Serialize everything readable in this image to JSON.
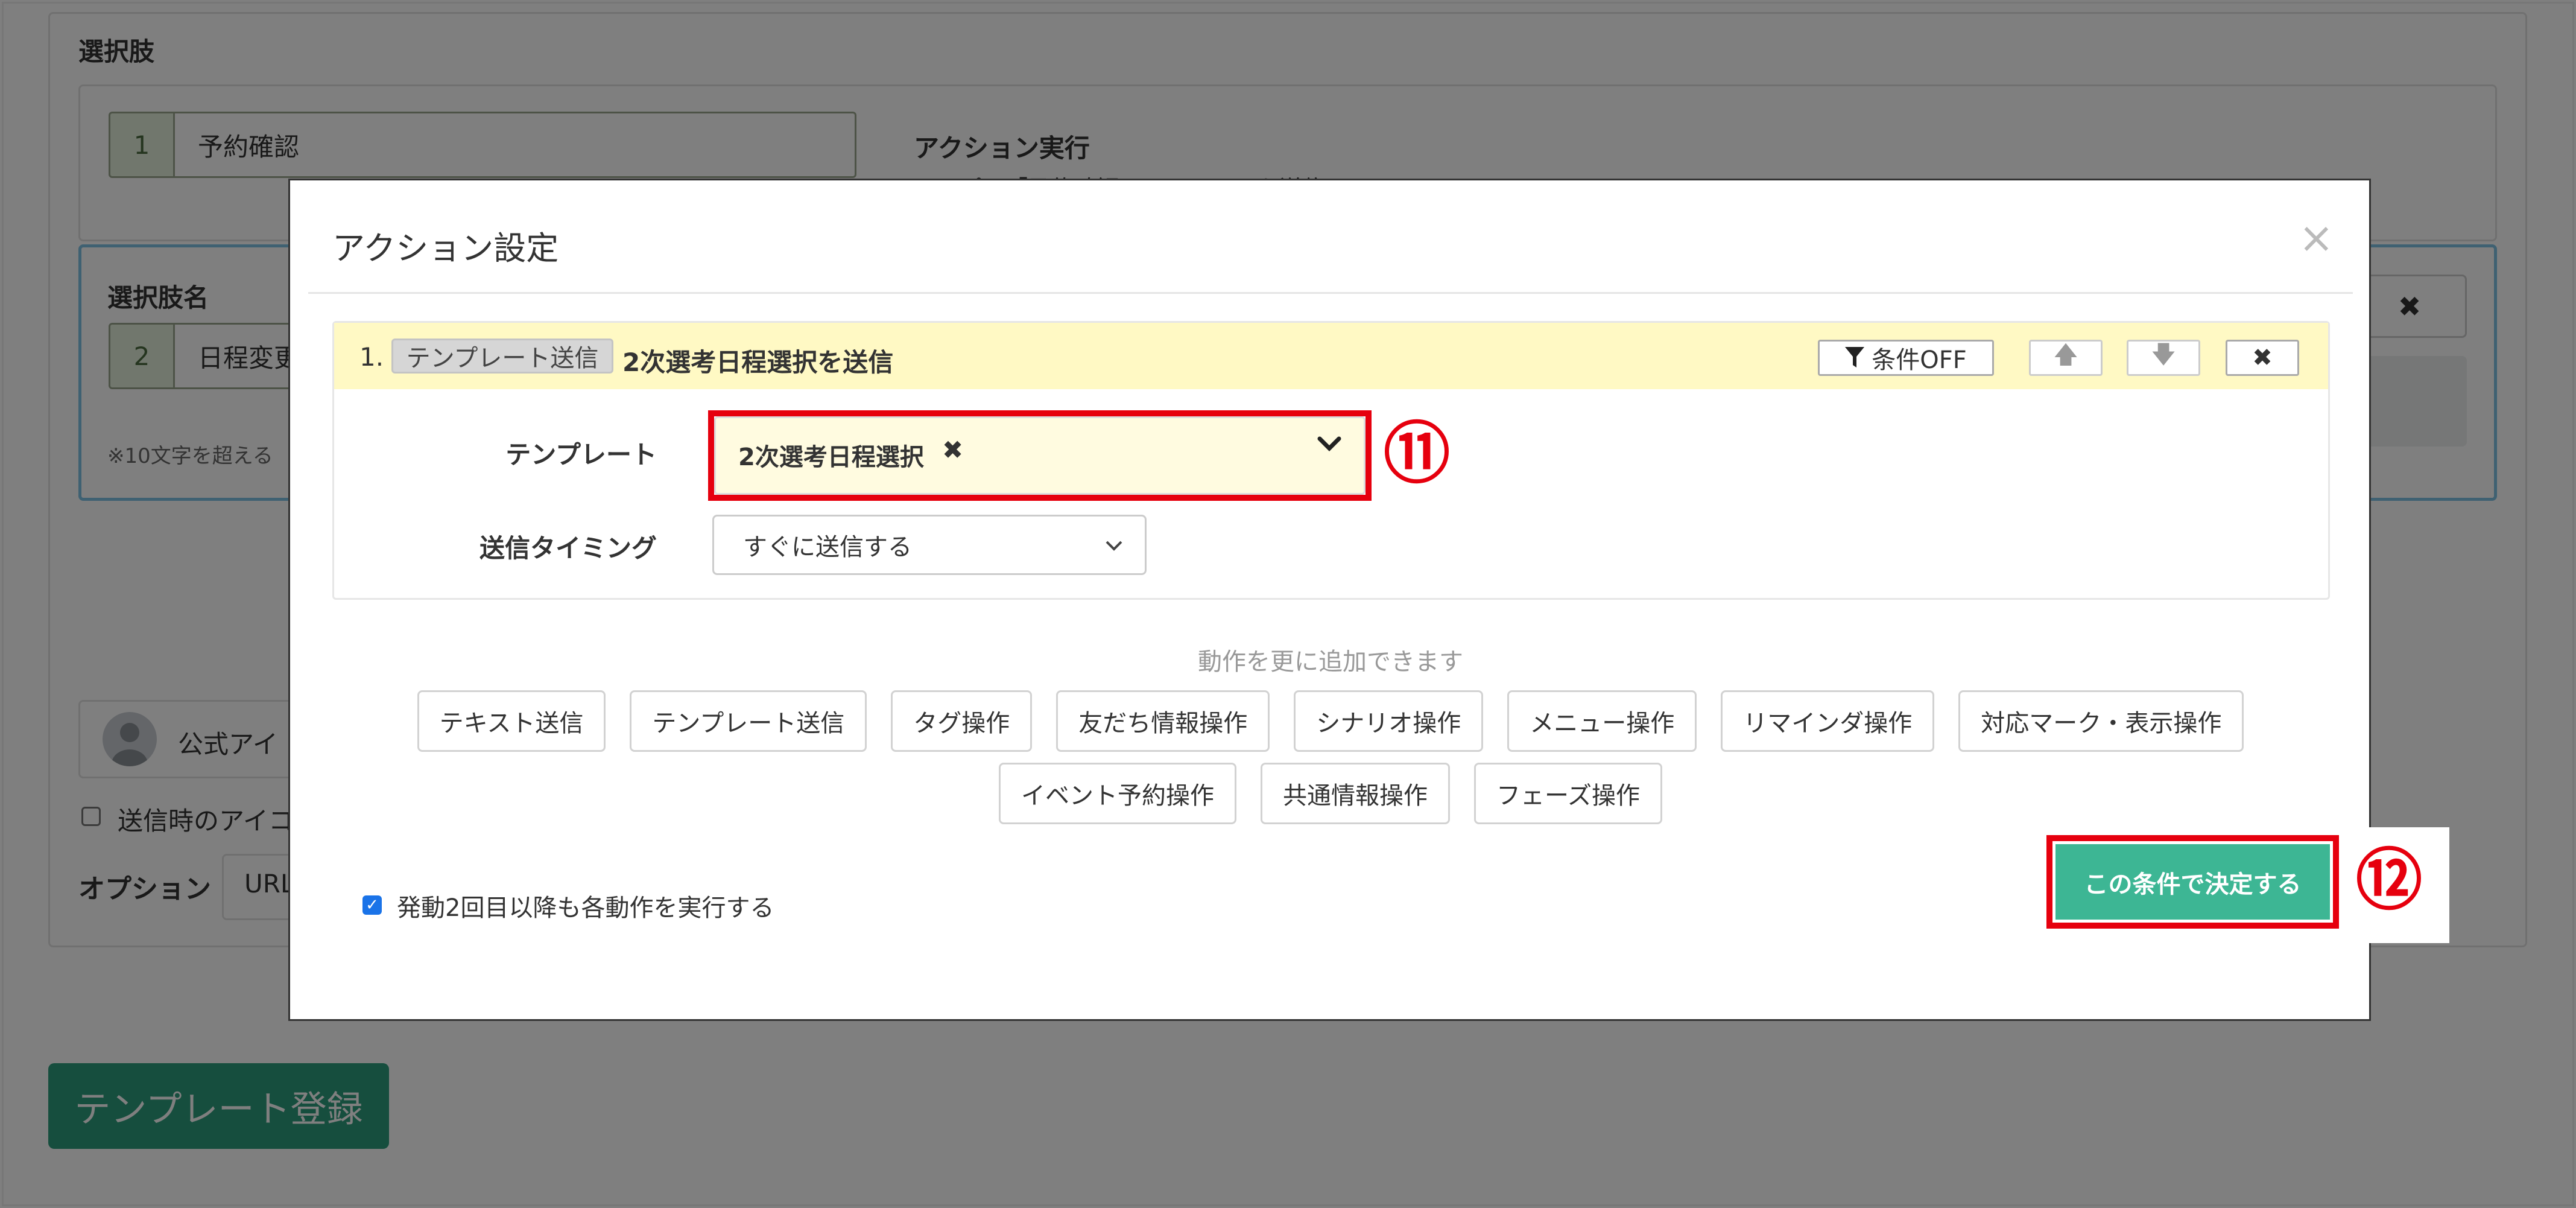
{
  "background": {
    "choices_label": "選択肢",
    "choice1": {
      "number": "1",
      "text": "予約確認"
    },
    "action_heading": "アクション実行",
    "action_desc_partial": "テンプレ「予約確認」メッセージを送信",
    "choice_name_label": "選択肢名",
    "choice2": {
      "number": "2",
      "text": "日程変更"
    },
    "length_note": "※10文字を超える",
    "delete_glyph": "✖",
    "account_name": "公式アイ",
    "icon_checkbox_label": "送信時のアイコ",
    "option_label": "オプション",
    "url_select": "URL",
    "register_button": "テンプレート登録"
  },
  "modal": {
    "title": "アクション設定",
    "close": "×",
    "action": {
      "index": "1.",
      "type_tag": "テンプレート送信",
      "name": "2次選考日程選択を送信",
      "cond_button": "条件OFF",
      "up_glyph": "🡅",
      "down_glyph": "🡇",
      "delete_glyph": "✖"
    },
    "template_label": "テンプレート",
    "template_value": "2次選考日程選択",
    "template_clear": "✖",
    "timing_label": "送信タイミング",
    "timing_value": "すぐに送信する",
    "add_hint": "動作を更に追加できます",
    "action_types_row1": [
      "テキスト送信",
      "テンプレート送信",
      "タグ操作",
      "友だち情報操作",
      "シナリオ操作",
      "メニュー操作",
      "リマインダ操作",
      "対応マーク・表示操作"
    ],
    "action_types_row2": [
      "イベント予約操作",
      "共通情報操作",
      "フェーズ操作"
    ],
    "repeat_checkbox_label": "発動2回目以降も各動作を実行する",
    "decide_button": "この条件で決定する"
  },
  "annotations": {
    "step11": "⑪",
    "step12": "⑫"
  },
  "colors": {
    "accent_red": "#e6000e",
    "decide_green": "#3db694",
    "register_green": "#2c9c7c",
    "highlight_yellow": "#fff9c4"
  }
}
